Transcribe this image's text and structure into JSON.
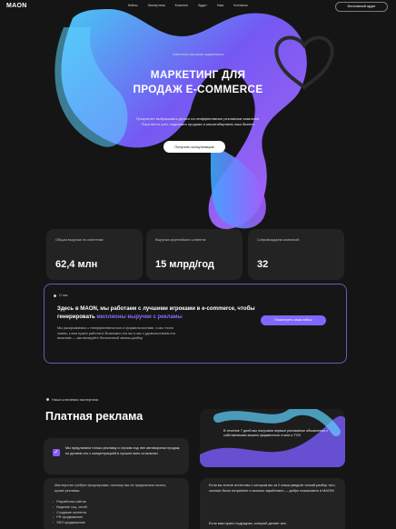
{
  "nav": {
    "logo": "MAON",
    "items": [
      "Кейсы",
      "Экспертиза",
      "Клиенты",
      "Аудит",
      "Наш",
      "Контакты"
    ],
    "audit_button": "Бесплатный аудит"
  },
  "hero": {
    "subtitle": "Агентство интернет-маркетинга",
    "title_line1": "МАРКЕТИНГ ДЛЯ",
    "title_line2": "ПРОДАЖ E-COMMERCE",
    "desc_line1": "Прекратите выбрасывать деньги на неэффективные рекламные кампании.",
    "desc_line2": "Пора вести учет, поднимать продажи и масштабировать ваш бизнес!",
    "cta": "Получить консультацию"
  },
  "stats": [
    {
      "label": "Общая выручка по клиентам:",
      "value": "62,4 млн"
    },
    {
      "label": "Выручка крупнейшего клиента:",
      "value": "15 млрд/год"
    },
    {
      "label": "Сопровождаем компаний:",
      "value": "32"
    }
  ],
  "about": {
    "tag": "О нас",
    "title_a": "Здесь в MAON, мы работаем с лучшими игроками в e-commerce, чтобы генерировать ",
    "title_highlight": "миллионы выручки с рекламы",
    "desc": "Мы раскрываемся с неэффективностью и формальностями, и мы точно знаем, к кем нужен работать! Возможно это вы и мы с удовольствием это выясним — запланируйте бесплатный звонок-разбор",
    "button": "Посмотреть наши кейсы"
  },
  "section": {
    "tag": "Наша ключевая экспертиза",
    "title": "Платная реклама"
  },
  "card_a": {
    "text": "Мы предлагаем только рекламу и строим под нее автоворонки продаж, но делаем это с концентрацией в лучшее всех остальных"
  },
  "card_b": {
    "text": "Мастерство требует фокусировки, поэтому мы не предлагаем ничего, кроме рекламы:",
    "items": [
      "Разработка сайтов",
      "Ведение соц. сетей",
      "Создание контента",
      "PR продвижение",
      "SEO продвижение"
    ]
  },
  "card_c": {
    "text": "В течение 7 дней мы получаем первые рекламные объявления с собственными вашего фирменного стиля и TOV"
  },
  "card_d": {
    "text": "Если вы хотите агентство с которым вы за 2 клика увидите четкий разбор того, сколько было потрачено и сколько заработано — добро пожаловать в MAON!",
    "text2": "Если вам нужно подрядчик, который делает все,"
  },
  "colors": {
    "accent": "#8266ff",
    "background": "#151515",
    "card": "#232323"
  }
}
